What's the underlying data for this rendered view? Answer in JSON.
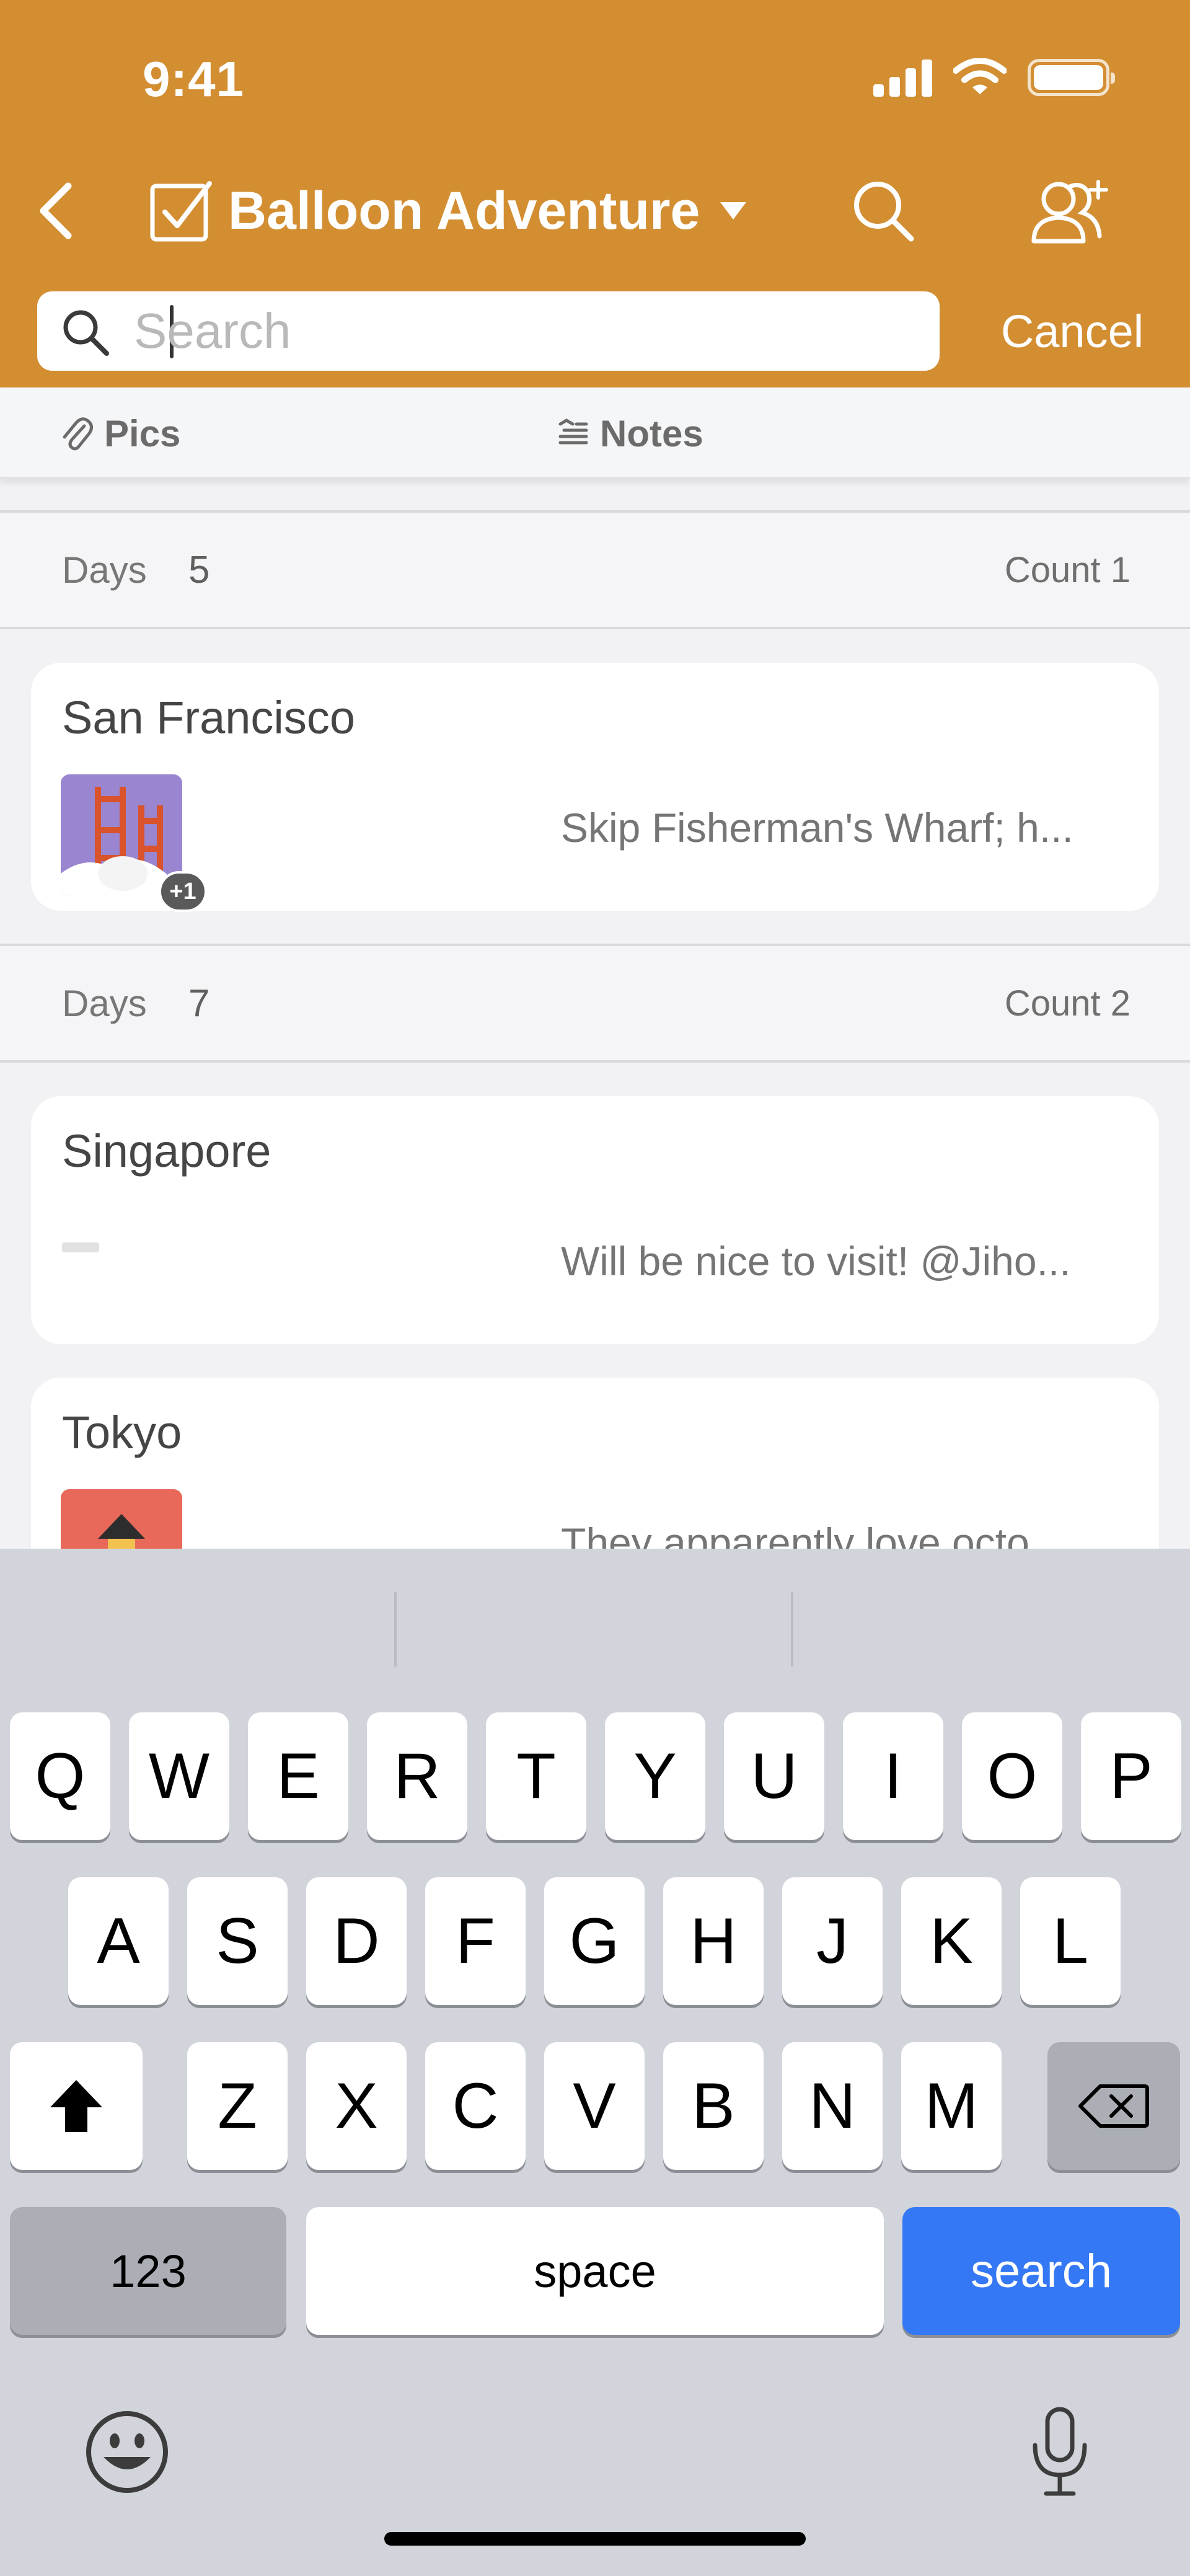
{
  "status_bar": {
    "time": "9:41"
  },
  "nav": {
    "title": "Balloon Adventure",
    "icons": {
      "back": "chevron-left-icon",
      "title": "checkbox-icon",
      "caret": "caret-down-icon",
      "search": "search-icon",
      "share": "add-person-icon"
    }
  },
  "search": {
    "placeholder": "Search",
    "value": "",
    "cancel_label": "Cancel"
  },
  "tabs": [
    {
      "label": "Pics",
      "icon": "paperclip-icon"
    },
    {
      "label": "Notes",
      "icon": "notes-icon"
    }
  ],
  "groups": [
    {
      "label": "Days",
      "value": "5",
      "count": "Count 1",
      "items": [
        {
          "title": "San Francisco",
          "note": "Skip Fisherman's Wharf; h...",
          "thumb": "golden-gate-bridge-image",
          "badge": "+1"
        }
      ]
    },
    {
      "label": "Days",
      "value": "7",
      "count": "Count 2",
      "items": [
        {
          "title": "Singapore",
          "note": "Will be nice to visit! @Jiho..."
        },
        {
          "title": "Tokyo",
          "note": "They apparently love octo...",
          "thumb": "pagoda-image"
        }
      ]
    }
  ],
  "keyboard": {
    "row1": [
      "Q",
      "W",
      "E",
      "R",
      "T",
      "Y",
      "U",
      "I",
      "O",
      "P"
    ],
    "row2": [
      "A",
      "S",
      "D",
      "F",
      "G",
      "H",
      "J",
      "K",
      "L"
    ],
    "row3": [
      "Z",
      "X",
      "C",
      "V",
      "B",
      "N",
      "M"
    ],
    "numbers_label": "123",
    "space_label": "space",
    "action_label": "search"
  },
  "colors": {
    "header": "#d38e32",
    "keyboard": "#d1d4db",
    "action_key": "#3478f6"
  }
}
